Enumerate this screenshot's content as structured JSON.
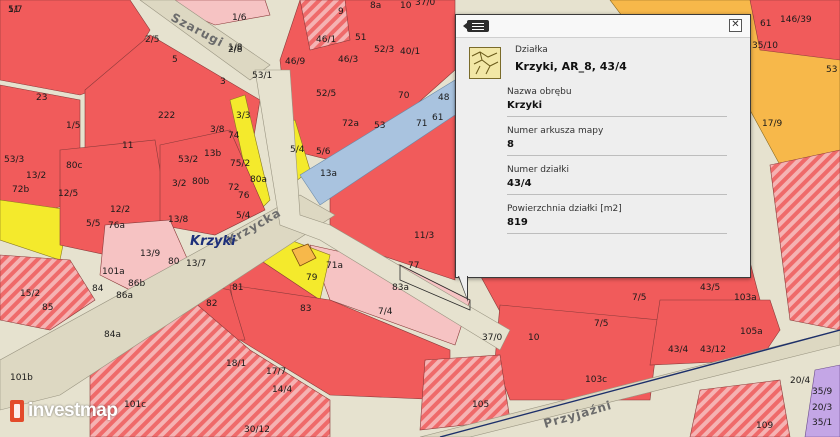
{
  "map": {
    "streets": [
      "Szarugi",
      "Krzycka",
      "Przyjaźni"
    ],
    "place_name": "Krzyki",
    "parcel_labels": [
      "1/7",
      "1/6",
      "1/8",
      "8a",
      "10",
      "9",
      "37/0",
      "51",
      "2/5",
      "5",
      "2/8",
      "46/9",
      "46/1",
      "46/3",
      "3",
      "23",
      "52/3",
      "40/1",
      "222",
      "53",
      "3/8",
      "74",
      "52/5",
      "71",
      "53/1",
      "70",
      "48",
      "72a",
      "1/5",
      "11",
      "75/2",
      "3/3",
      "53/2",
      "72",
      "13b",
      "5/4",
      "3/2",
      "5/6",
      "13a",
      "53/3",
      "72b",
      "80c",
      "13/2",
      "12/5",
      "80b",
      "80a",
      "5/4",
      "5/5",
      "76",
      "13/8",
      "76a",
      "12/2",
      "80",
      "13/9",
      "82",
      "13/7",
      "81",
      "11/3",
      "79",
      "71a",
      "7/4",
      "77",
      "7/5",
      "43/5",
      "103a",
      "101a",
      "15/2",
      "85",
      "86b",
      "86a",
      "84",
      "84a",
      "18/1",
      "14/4",
      "17/7",
      "83",
      "83a",
      "37/0",
      "10",
      "7/5",
      "43/4",
      "43/12",
      "105a",
      "103c",
      "101c",
      "101b",
      "105",
      "20/4",
      "20/3",
      "109",
      "35/1",
      "35/9",
      "30/12",
      "35/10",
      "146/39",
      "17/9",
      "53",
      "61",
      "61",
      "51"
    ]
  },
  "popup": {
    "kind": "Działka",
    "title": "Krzyki, AR_8, 43/4",
    "fields": [
      {
        "label": "Nazwa obrębu",
        "value": "Krzyki"
      },
      {
        "label": "Numer arkusza mapy",
        "value": "8"
      },
      {
        "label": "Numer działki",
        "value": "43/4"
      },
      {
        "label": "Powierzchnia działki [m2]",
        "value": "819"
      }
    ],
    "close_glyph": "✕"
  },
  "logo": {
    "text": "investmap"
  },
  "colors": {
    "parcel_red": "#f15b5b",
    "parcel_pink": "#f6c3c3",
    "parcel_yellow": "#f4ea2c",
    "parcel_orange": "#f7b84a",
    "road_blue": "#a9c3df",
    "road_beige": "#e6e2cf",
    "popup_bg": "#eeeeee"
  }
}
